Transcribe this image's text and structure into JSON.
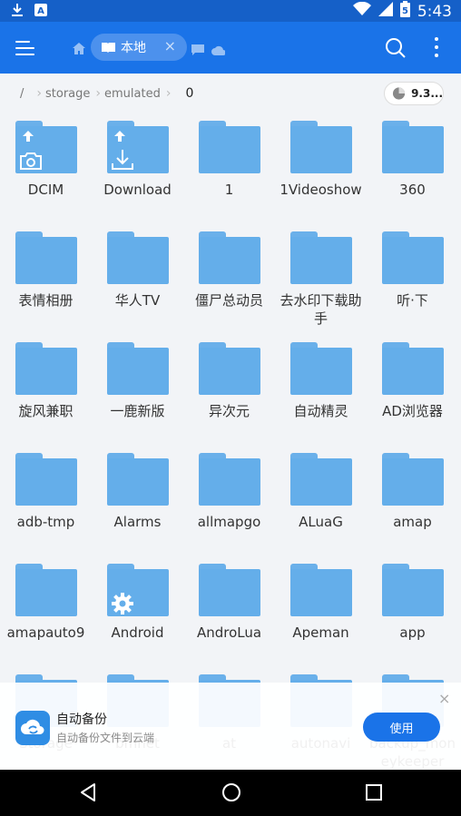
{
  "status_bar": {
    "time": "5:43",
    "icons": [
      "download-icon",
      "notification-a-icon",
      "wifi-icon",
      "signal-icon",
      "battery-icon"
    ],
    "battery_glyph": "5"
  },
  "app_bar": {
    "tab_label": "本地",
    "colors": {
      "primary": "#1a73e8",
      "status": "#1560c8"
    }
  },
  "breadcrumb": {
    "root": "/",
    "items": [
      "storage",
      "emulated",
      "0"
    ]
  },
  "storage_chip": {
    "label": "9.3..."
  },
  "folders": [
    {
      "name": "DCIM",
      "overlay": "upload-camera"
    },
    {
      "name": "Download",
      "overlay": "upload-download"
    },
    {
      "name": "1"
    },
    {
      "name": "1Videoshow"
    },
    {
      "name": "360"
    },
    {
      "name": "表情相册"
    },
    {
      "name": "华人TV"
    },
    {
      "name": "僵尸总动员"
    },
    {
      "name": "去水印下载助手"
    },
    {
      "name": "听·下"
    },
    {
      "name": "旋风兼职"
    },
    {
      "name": "一鹿新版"
    },
    {
      "name": "异次元"
    },
    {
      "name": "自动精灵"
    },
    {
      "name": "AD浏览器"
    },
    {
      "name": "adb-tmp"
    },
    {
      "name": "Alarms"
    },
    {
      "name": "allmapgo"
    },
    {
      "name": "ALuaG"
    },
    {
      "name": "amap"
    },
    {
      "name": "amapauto9"
    },
    {
      "name": "Android",
      "overlay": "gear"
    },
    {
      "name": "AndroLua"
    },
    {
      "name": "Apeman"
    },
    {
      "name": "app"
    },
    {
      "name": "Storage"
    },
    {
      "name": "bmnet"
    },
    {
      "name": "at"
    },
    {
      "name": "autonavi"
    },
    {
      "name": "backup_moneykeeper"
    }
  ],
  "banner": {
    "title": "自动备份",
    "subtitle": "自动备份文件到云端",
    "button": "使用",
    "close": "×"
  },
  "nav_bar": {
    "buttons": [
      "back-icon",
      "home-circle-icon",
      "recents-square-icon"
    ]
  }
}
